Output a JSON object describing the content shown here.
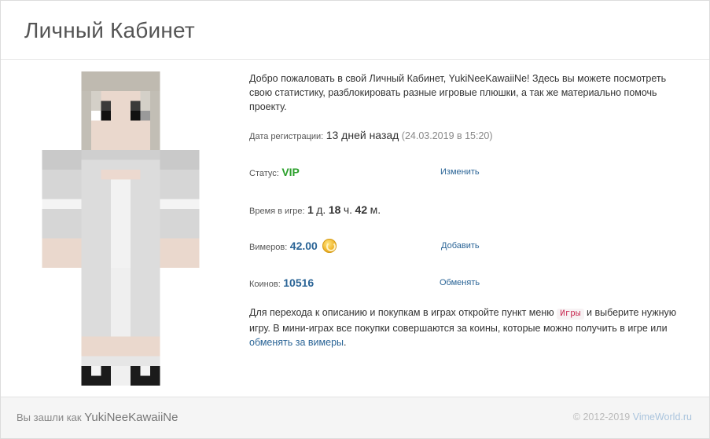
{
  "header": {
    "title": "Личный Кабинет"
  },
  "intro": {
    "text": "Добро пожаловать в свой Личный Кабинет, YukiNeeKawaiiNe! Здесь вы можете посмотреть свою статистику, разблокировать разные игровые плюшки, а так же материально помочь проекту."
  },
  "registration": {
    "label": "Дата регистрации:",
    "relative": "13 дней назад",
    "date": "(24.03.2019 в 15:20)"
  },
  "status": {
    "label": "Статус:",
    "value": "VIP",
    "value_color": "#2ca02c",
    "action": "Изменить"
  },
  "playtime": {
    "label": "Время в игре:",
    "days": "1",
    "days_unit": "д.",
    "hours": "18",
    "hours_unit": "ч.",
    "minutes": "42",
    "minutes_unit": "м."
  },
  "vimers": {
    "label": "Вимеров:",
    "value": "42.00",
    "icon": "coin-icon",
    "action": "Добавить"
  },
  "coins": {
    "label": "Коинов:",
    "value": "10516",
    "action": "Обменять"
  },
  "info": {
    "text_before": "Для перехода к описанию и покупкам в играх откройте пункт меню",
    "menu_item": "Игры",
    "text_middle": "и выберите нужную игру. В мини-играх все покупки совершаются за коины, которые можно получить в игре или",
    "link_text": "обменять за вимеры",
    "text_after": "."
  },
  "footer": {
    "logged_in_prefix": "Вы зашли как",
    "username": "YukiNeeKawaiiNe",
    "copyright": "© 2012-2019",
    "site_link": "VimeWorld.ru"
  },
  "colors": {
    "link": "#2a6496",
    "accent_number": "#2a6496"
  }
}
